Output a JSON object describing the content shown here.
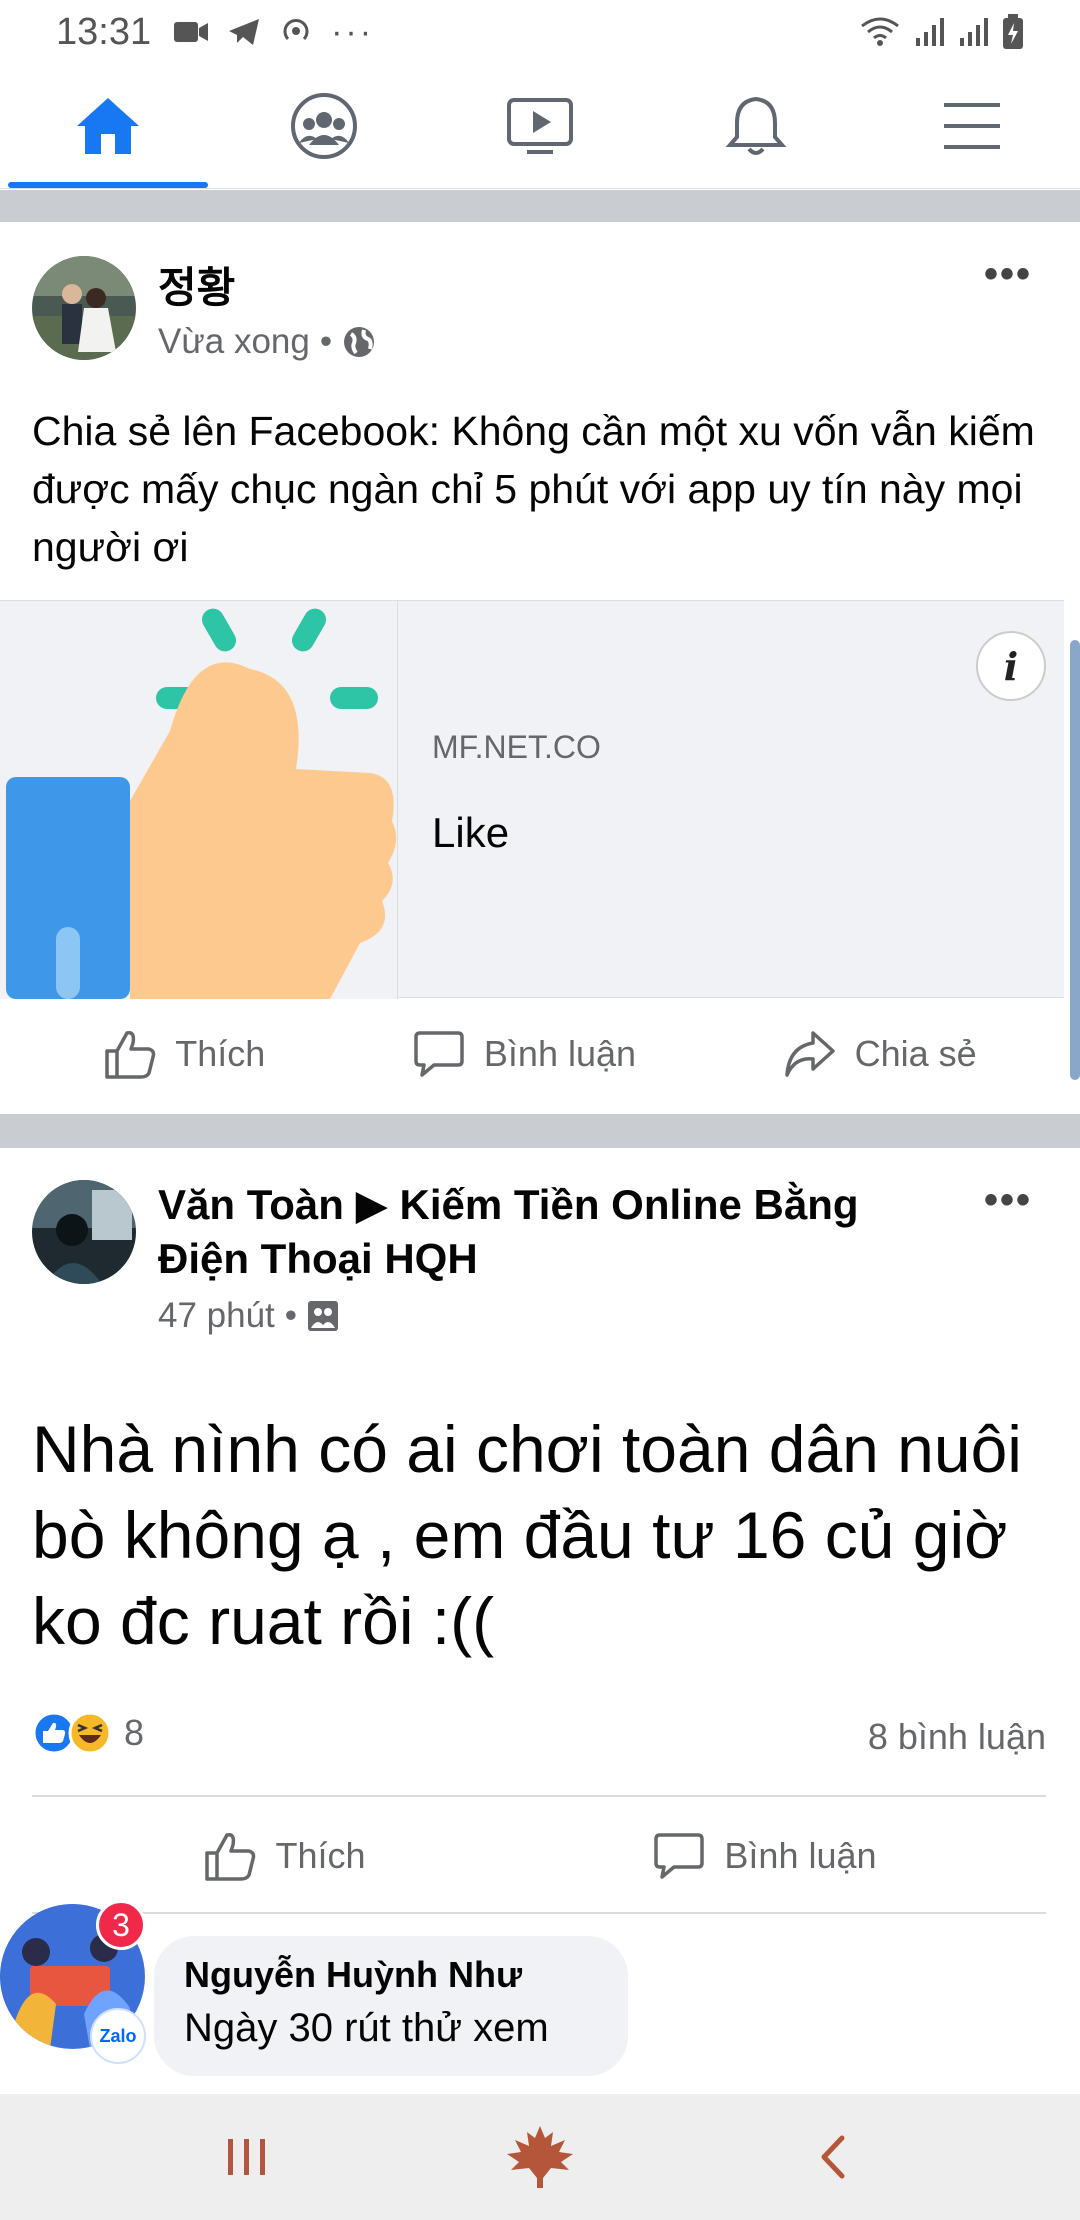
{
  "status_bar": {
    "time": "13:31",
    "icons": [
      "video-icon",
      "telegram-icon",
      "hotspot-icon",
      "more-dots-icon"
    ],
    "right_icons": [
      "wifi-icon",
      "signal-icon",
      "signal-icon",
      "battery-charging-icon"
    ]
  },
  "top_nav": {
    "tabs": [
      {
        "icon": "home-icon",
        "active": true
      },
      {
        "icon": "groups-icon",
        "active": false
      },
      {
        "icon": "watch-icon",
        "active": false
      },
      {
        "icon": "bell-icon",
        "active": false
      },
      {
        "icon": "menu-icon",
        "active": false
      }
    ],
    "accent": "#1877f2"
  },
  "post1": {
    "author": "정황",
    "time": "Vừa xong",
    "text": "Chia sẻ lên Facebook: Không cần một xu vốn vẫn kiếm được mấy chục ngàn chỉ 5 phút với app uy tín này mọi người ơi",
    "link": {
      "domain": "MF.NET.CO",
      "title": "Like",
      "info_label": "i"
    },
    "actions": {
      "like": "Thích",
      "comment": "Bình luận",
      "share": "Chia sẻ"
    }
  },
  "post2": {
    "author": "Văn Toàn ▶ Kiếm Tiền Online Bằng Điện Thoại HQH",
    "time": "47 phút",
    "text": "Nhà nình có ai chơi toàn dân nuôi bò không ạ , em đầu tư 16 củ giờ ko đc ruat rồi :((",
    "reaction_count": "8",
    "comment_count": "8 bình luận",
    "actions": {
      "like": "Thích",
      "comment": "Bình luận"
    }
  },
  "chat_head": {
    "badge": "3",
    "app_tag": "Zalo",
    "sender": "Nguyễn Huỳnh Như",
    "message": "Ngày 30 rút thử xem"
  },
  "system_nav": {
    "buttons": [
      "recent-apps-icon",
      "home-leaf-icon",
      "back-icon"
    ],
    "color": "#b5563a"
  }
}
